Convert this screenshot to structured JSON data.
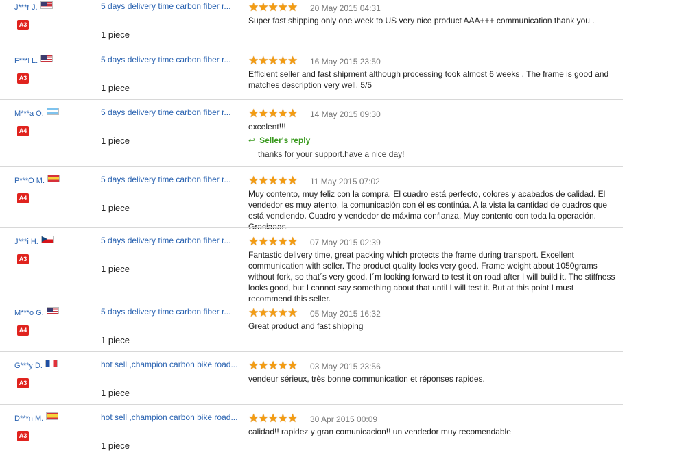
{
  "reviews": [
    {
      "buyer": "J***r J.",
      "flag": "US",
      "badge": "A3",
      "product": "5 days delivery time carbon fiber r...",
      "quantity": "1 piece",
      "stars": "★★★★★",
      "date": "20 May 2015 04:31",
      "comment": "Super fast shipping only one week to US very nice product AAA+++ communication thank you ."
    },
    {
      "buyer": "F***l L.",
      "flag": "US",
      "badge": "A3",
      "product": "5 days delivery time carbon fiber r...",
      "quantity": "1 piece",
      "stars": "★★★★★",
      "date": "16 May 2015 23:50",
      "comment": "Efficient seller and fast shipment although processing took almost 6 weeks . The frame is good and matches description very well. 5/5"
    },
    {
      "buyer": "M***a O.",
      "flag": "AR",
      "badge": "A4",
      "product": "5 days delivery time carbon fiber r...",
      "quantity": "1 piece",
      "stars": "★★★★★",
      "date": "14 May 2015 09:30",
      "comment": "excelent!!!",
      "reply_label": "Seller's reply",
      "reply_icon": "↩",
      "reply_text": "thanks for your support.have a nice day!"
    },
    {
      "buyer": "P***O M.",
      "flag": "ES",
      "badge": "A4",
      "product": "5 days delivery time carbon fiber r...",
      "quantity": "1 piece",
      "stars": "★★★★★",
      "date": "11 May 2015 07:02",
      "comment": "Muy contento, muy feliz con la compra. El cuadro está perfecto, colores y acabados de calidad. El vendedor es muy atento, la comunicación con él es continúa. A la vista la cantidad de cuadros que está vendiendo. Cuadro y vendedor de máxima confianza. Muy contento con toda la operación. Graciaaas."
    },
    {
      "buyer": "J***i H.",
      "flag": "CZ",
      "badge": "A3",
      "product": "5 days delivery time carbon fiber r...",
      "quantity": "1 piece",
      "stars": "★★★★★",
      "date": "07 May 2015 02:39",
      "comment": "Fantastic delivery time, great packing which protects the frame during transport. Excellent communication with seller. The product quality looks very good. Frame weight about 1050grams without fork, so that´s very good. I´m looking forward to test it on road after I will build it. The stiffness looks good, but I cannot say something about that until I will test it. But at this point I must recommend this seller."
    },
    {
      "buyer": "M***o G.",
      "flag": "US",
      "badge": "A4",
      "product": "5 days delivery time carbon fiber r...",
      "quantity": "1 piece",
      "stars": "★★★★★",
      "date": "05 May 2015 16:32",
      "comment": "Great product and fast shipping"
    },
    {
      "buyer": "G***y D.",
      "flag": "FR",
      "badge": "A3",
      "product": "hot sell ,champion carbon bike road...",
      "quantity": "1 piece",
      "stars": "★★★★★",
      "date": "03 May 2015 23:56",
      "comment": "vendeur sérieux, très bonne communication et réponses rapides."
    },
    {
      "buyer": "D***n M.",
      "flag": "ES",
      "badge": "A3",
      "product": "hot sell ,champion carbon bike road...",
      "quantity": "1 piece",
      "stars": "★★★★★",
      "date": "30 Apr 2015 00:09",
      "comment": "calidad!! rapidez y gran comunicacion!! un vendedor muy recomendable"
    }
  ]
}
